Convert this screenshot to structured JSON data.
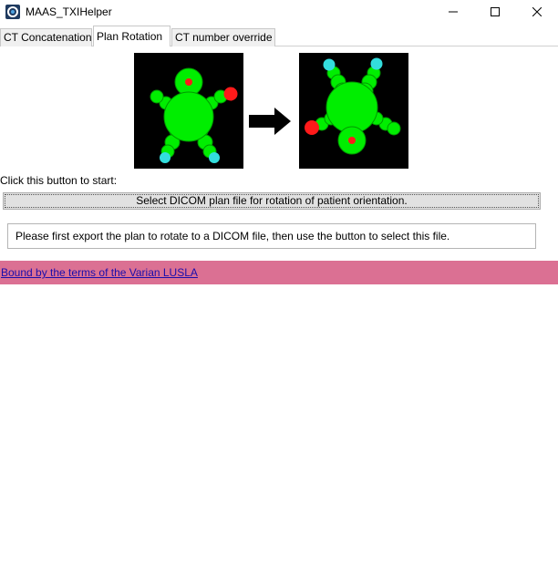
{
  "window": {
    "title": "MAAS_TXIHelper",
    "icon": "app-logo-icon",
    "controls": [
      "minimize-icon",
      "maximize-icon",
      "close-icon"
    ]
  },
  "tabs": [
    {
      "label": "CT Concatenation",
      "active": false
    },
    {
      "label": "Plan Rotation",
      "active": true
    },
    {
      "label": "CT number override",
      "active": false
    }
  ],
  "main": {
    "illustration": {
      "left_image": "patient-figure-head-up-icon",
      "arrow": "right-arrow-icon",
      "right_image": "patient-figure-head-down-icon"
    },
    "start_label": "Click this button to start:",
    "select_button_label": "Select DICOM plan file for rotation of patient orientation.",
    "info_text": "Please first export the plan to rotate to a DICOM file, then use the button to select this file."
  },
  "footer": {
    "link_text": "Bound by the terms of the Varian LUSLA",
    "background": "#db7093"
  },
  "colors": {
    "figure_body": "#00ee00",
    "figure_red_marker": "#ff1a1a",
    "figure_cyan_marker": "#33dddd",
    "image_background": "#000000"
  }
}
